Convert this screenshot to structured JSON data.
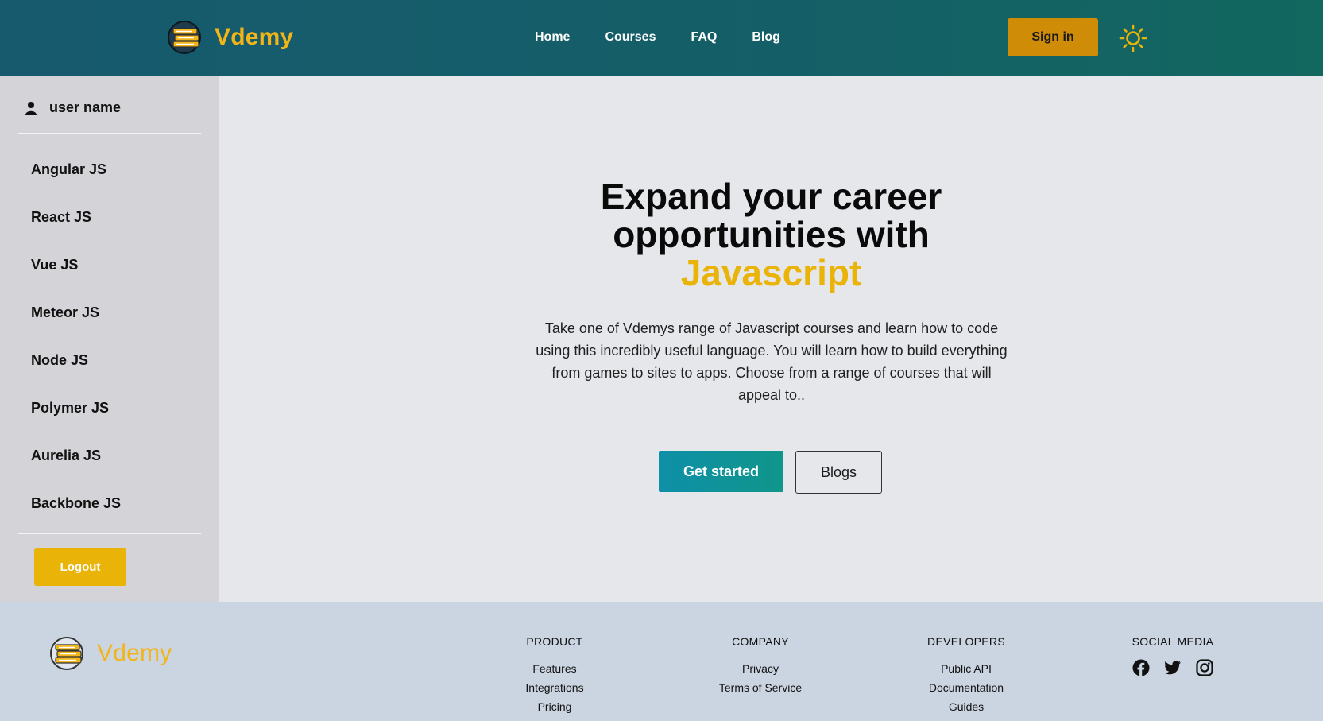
{
  "header": {
    "brand": "Vdemy",
    "nav": [
      "Home",
      "Courses",
      "FAQ",
      "Blog"
    ],
    "signin_label": "Sign in",
    "theme_icon": "sun-icon"
  },
  "sidebar": {
    "user_name": "user name",
    "items": [
      "Angular JS",
      "React JS",
      "Vue JS",
      "Meteor JS",
      "Node JS",
      "Polymer JS",
      "Aurelia JS",
      "Backbone JS"
    ],
    "logout_label": "Logout"
  },
  "hero": {
    "title_line1": "Expand your career",
    "title_line2": "opportunities with",
    "title_highlight": "Javascript",
    "description": "Take one of Vdemys range of Javascript courses and learn how to code using this incredibly useful language. You will learn how to build everything from games to sites to apps. Choose from a range of courses that will appeal to..",
    "primary_button": "Get started",
    "secondary_button": "Blogs"
  },
  "footer": {
    "brand": "Vdemy",
    "columns": [
      {
        "title": "PRODUCT",
        "links": [
          "Features",
          "Integrations",
          "Pricing"
        ]
      },
      {
        "title": "COMPANY",
        "links": [
          "Privacy",
          "Terms of Service"
        ]
      },
      {
        "title": "DEVELOPERS",
        "links": [
          "Public API",
          "Documentation",
          "Guides"
        ]
      },
      {
        "title": "SOCIAL MEDIA",
        "icons": [
          "facebook-icon",
          "twitter-icon",
          "instagram-icon"
        ]
      }
    ]
  },
  "colors": {
    "brand_yellow": "#eab308",
    "header_teal": "#175a6e",
    "signin_orange": "#cf8c06",
    "sidebar_bg": "#d4d4d8",
    "footer_bg": "#cbd5e1"
  }
}
